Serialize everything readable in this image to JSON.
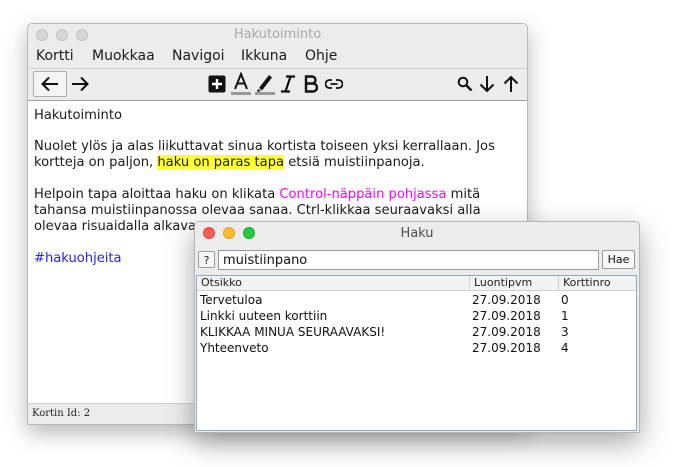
{
  "main_window": {
    "title": "Hakutoiminto",
    "menu": [
      "Kortti",
      "Muokkaa",
      "Navigoi",
      "Ikkuna",
      "Ohje"
    ],
    "toolbar": {
      "back_icon": "arrow-left-icon",
      "forward_icon": "arrow-right-icon",
      "add_icon": "plus-square-icon",
      "text_color_icon": "font-color-icon",
      "highlight_icon": "highlighter-pen-icon",
      "italic_icon": "italic-icon",
      "bold_icon": "bold-icon",
      "link_icon": "link-icon",
      "search_icon": "search-icon",
      "next_icon": "arrow-down-icon",
      "prev_icon": "arrow-up-icon"
    },
    "content": {
      "heading": "Hakutoiminto",
      "p1_before": "Nuolet ylös ja alas liikuttavat sinua kortista toiseen yksi kerrallaan. Jos kortteja on paljon, ",
      "p1_highlight": "haku on paras tapa",
      "p1_after": " etsiä muistiinpanoja.",
      "p2_before": "Helpoin tapa aloittaa haku on klikata ",
      "p2_link": "Control-näppäin pohjassa",
      "p2_after": " mitä tahansa muistiinpanossa olevaa sanaa. Ctrl-klikkaa seuraavaksi alla olevaa risuaidalla alkavaa sanaa:",
      "tag": "#hakuohjeita"
    },
    "status": "Kortin Id: 2",
    "colors": {
      "highlight": "#ffff33",
      "link": "#ff00ff",
      "tag": "#2323ee"
    }
  },
  "search_window": {
    "title": "Haku",
    "help_label": "?",
    "query": "muistiinpano",
    "search_button": "Hae",
    "columns": [
      "Otsikko",
      "Luontipvm",
      "Korttinro"
    ],
    "rows": [
      [
        "Tervetuloa",
        "27.09.2018",
        "0"
      ],
      [
        "Linkki uuteen korttiin",
        "27.09.2018",
        "1"
      ],
      [
        "KLIKKAA MINUA SEURAAVAKSI!",
        "27.09.2018",
        "3"
      ],
      [
        "Yhteenveto",
        "27.09.2018",
        "4"
      ]
    ]
  }
}
